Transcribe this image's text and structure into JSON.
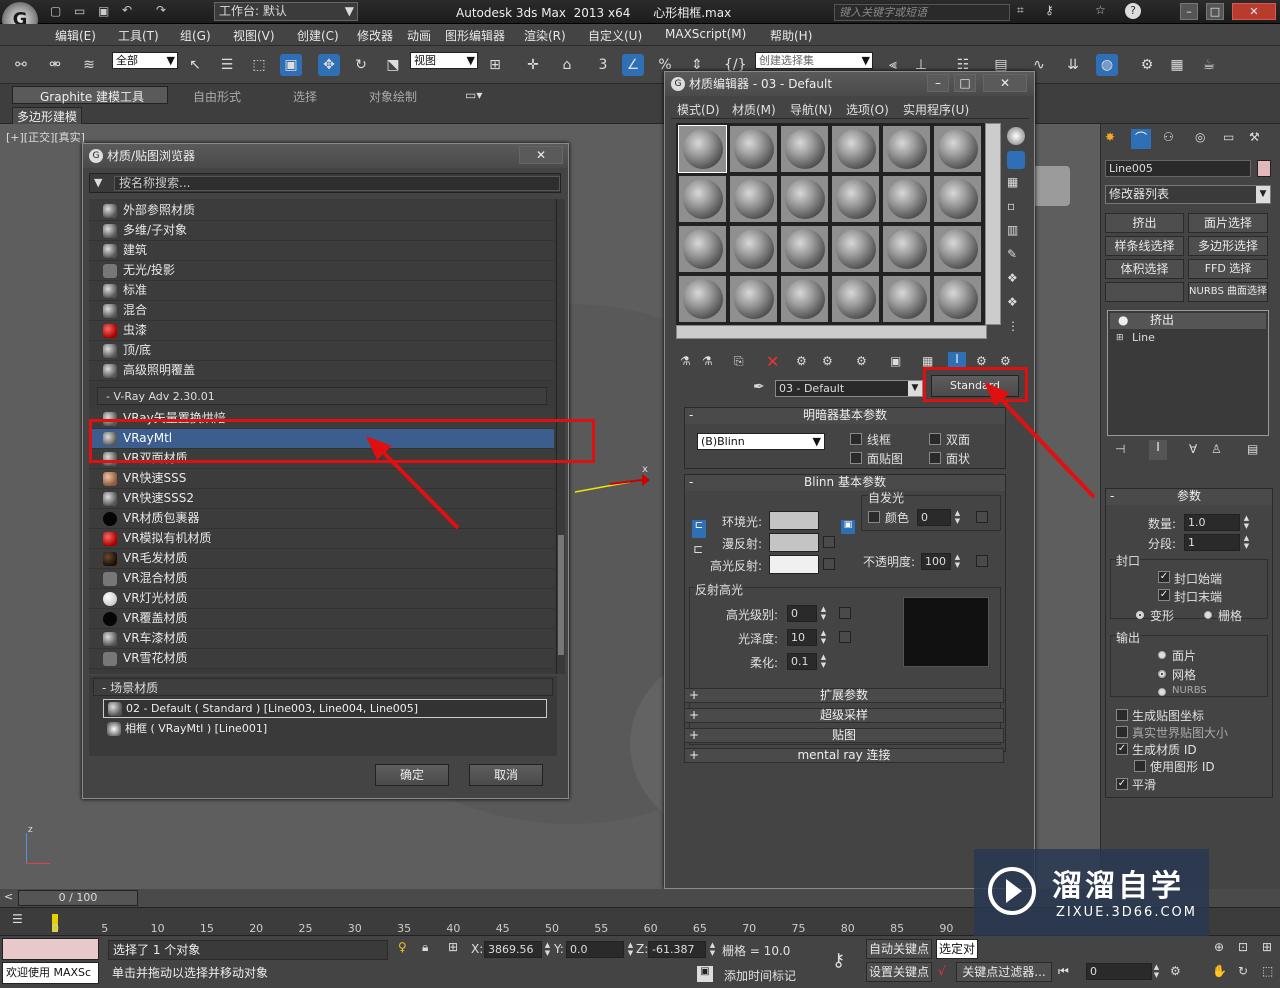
{
  "app": {
    "title": "Autodesk 3ds Max  2013 x64      心形相框.max",
    "workspace_label": "工作台: 默认",
    "search_placeholder": "键入关键字或短语"
  },
  "menu": [
    "编辑(E)",
    "工具(T)",
    "组(G)",
    "视图(V)",
    "创建(C)",
    "修改器",
    "动画",
    "图形编辑器",
    "渲染(R)",
    "自定义(U)",
    "MAXScript(M)",
    "帮助(H)"
  ],
  "toolbar": {
    "selection_filter": "全部",
    "ref_coord": "视图",
    "named_selection": "创建选择集",
    "snap_number": "3"
  },
  "ribbon": {
    "tabs": [
      "Graphite 建模工具",
      "自由形式",
      "选择",
      "对象绘制"
    ],
    "sub_tab": "多边形建模"
  },
  "viewport": {
    "label": "[+][正交][真实]",
    "axis_x": "x",
    "axis_z": "z"
  },
  "browser": {
    "title": "材质/贴图浏览器",
    "search_placeholder": "按名称搜索...",
    "standard_items": [
      {
        "label": "外部参照材质",
        "icon": "grey"
      },
      {
        "label": "多维/子对象",
        "icon": "grey"
      },
      {
        "label": "建筑",
        "icon": "grey"
      },
      {
        "label": "无光/投影",
        "icon": "flat"
      },
      {
        "label": "标准",
        "icon": "grey"
      },
      {
        "label": "混合",
        "icon": "grey"
      },
      {
        "label": "虫漆",
        "icon": "red"
      },
      {
        "label": "顶/底",
        "icon": "grey"
      },
      {
        "label": "高级照明覆盖",
        "icon": "grey"
      }
    ],
    "vray_group": "- V-Ray Adv 2.30.01",
    "vray_items": [
      {
        "label": "VRay矢量置换烘焙",
        "icon": "grey"
      },
      {
        "label": "VRayMtl",
        "icon": "grey",
        "selected": true
      },
      {
        "label": "VR双面材质",
        "icon": "grey"
      },
      {
        "label": "VR快速SSS",
        "icon": "skin"
      },
      {
        "label": "VR快速SSS2",
        "icon": "grey"
      },
      {
        "label": "VR材质包裹器",
        "icon": "black"
      },
      {
        "label": "VR模拟有机材质",
        "icon": "red"
      },
      {
        "label": "VR毛发材质",
        "icon": "dark"
      },
      {
        "label": "VR混合材质",
        "icon": "flat"
      },
      {
        "label": "VR灯光材质",
        "icon": "white"
      },
      {
        "label": "VR覆盖材质",
        "icon": "black"
      },
      {
        "label": "VR车漆材质",
        "icon": "grey"
      },
      {
        "label": "VR雪花材质",
        "icon": "flat"
      }
    ],
    "scene_group": "- 场景材质",
    "scene_items": [
      "02 - Default  ( Standard ) [Line003, Line004, Line005]",
      "相框  ( VRayMtl ) [Line001]"
    ],
    "ok": "确定",
    "cancel": "取消"
  },
  "mated": {
    "title": "材质编辑器 - 03 - Default",
    "menu": [
      "模式(D)",
      "材质(M)",
      "导航(N)",
      "选项(O)",
      "实用程序(U)"
    ],
    "material_name": "03 - Default",
    "material_type": "Standard",
    "shader_rollout": "明暗器基本参数",
    "shader": "(B)Blinn",
    "wire": "线框",
    "two_sided": "双面",
    "face_map": "面贴图",
    "faceted": "面状",
    "blinn_rollout": "Blinn 基本参数",
    "self_illum": "自发光",
    "color": "颜色",
    "self_illum_val": "0",
    "ambient": "环境光:",
    "diffuse": "漫反射:",
    "specular": "高光反射:",
    "opacity": "不透明度:",
    "opacity_val": "100",
    "spec_group": "反射高光",
    "spec_level": "高光级别:",
    "spec_level_val": "0",
    "gloss": "光泽度:",
    "gloss_val": "10",
    "soften": "柔化:",
    "soften_val": "0.1",
    "rollouts": [
      "扩展参数",
      "超级采样",
      "贴图",
      "mental ray 连接"
    ]
  },
  "cmd": {
    "object_name": "Line005",
    "modifier_list": "修改器列表",
    "buttons": [
      "挤出",
      "面片选择",
      "样条线选择",
      "多边形选择",
      "体积选择",
      "FFD 选择",
      "",
      "NURBS 曲面选择"
    ],
    "stack": [
      "挤出",
      "Line"
    ],
    "params": "参数",
    "amount": "数量:",
    "amount_val": "1.0",
    "segments": "分段:",
    "segments_val": "1",
    "capping": "封口",
    "cap_start": "封口始端",
    "cap_end": "封口末端",
    "morph": "变形",
    "grid": "栅格",
    "output": "输出",
    "patch": "面片",
    "mesh": "网格",
    "nurbs": "NURBS",
    "gen_map": "生成贴图坐标",
    "real_world": "真实世界贴图大小",
    "gen_matid": "生成材质 ID",
    "use_shape": "使用图形 ID",
    "smooth": "平滑"
  },
  "timeline": {
    "frame": "0 / 100",
    "ticks": [
      "0",
      "5",
      "10",
      "15",
      "20",
      "25",
      "30",
      "35",
      "40",
      "45",
      "50",
      "55",
      "60",
      "65",
      "70",
      "75",
      "80",
      "85",
      "90"
    ]
  },
  "status": {
    "welcome": "欢迎使用 MAXSc",
    "selected": "选择了 1 个对象",
    "hint": "单击并拖动以选择并移动对象",
    "x": "3869.56",
    "y": "0.0",
    "z": "-61.387",
    "grid": "栅格 = 10.0",
    "autokey": "自动关键点",
    "selected_obj": "选定对",
    "setkey": "设置关键点",
    "key_filter": "关键点过滤器...",
    "add_time_tag": "添加时间标记",
    "frame": "0"
  },
  "watermark": {
    "brand": "溜溜自学",
    "url": "ZIXUE.3D66.COM"
  }
}
